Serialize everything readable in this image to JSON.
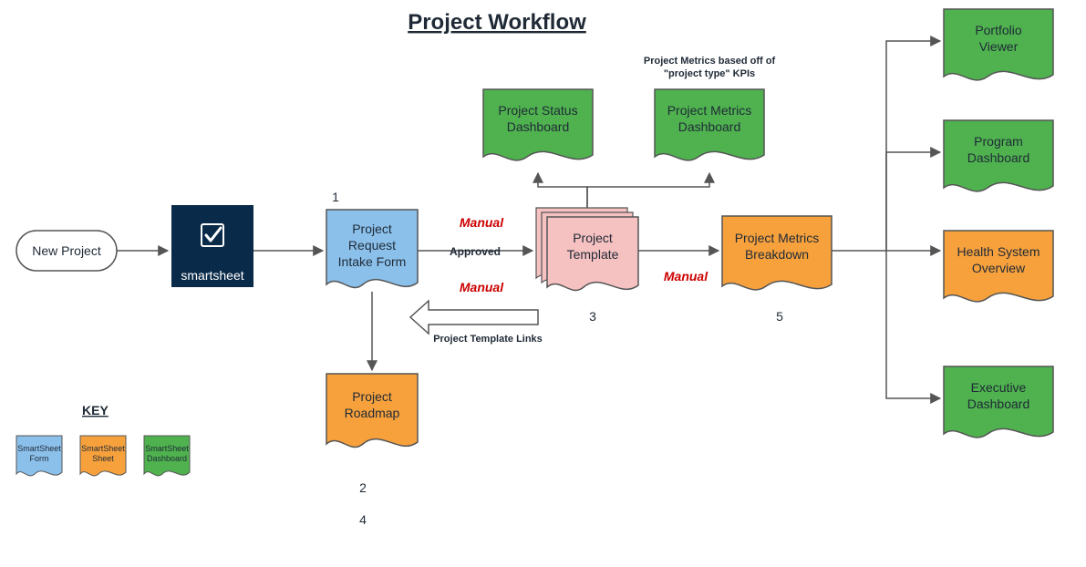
{
  "title": "Project Workflow",
  "key": {
    "heading": "KEY",
    "form": {
      "line1": "SmartSheet",
      "line2": "Form"
    },
    "sheet": {
      "line1": "SmartSheet",
      "line2": "Sheet"
    },
    "dashboard": {
      "line1": "SmartSheet",
      "line2": "Dashboard"
    }
  },
  "nodes": {
    "newProject": "New Project",
    "smartsheet": "smartsheet",
    "intake": {
      "line1": "Project",
      "line2": "Request",
      "line3": "Intake Form"
    },
    "roadmap": {
      "line1": "Project",
      "line2": "Roadmap"
    },
    "template": {
      "line1": "Project",
      "line2": "Template"
    },
    "status": {
      "line1": "Project Status",
      "line2": "Dashboard"
    },
    "metricsDash": {
      "line1": "Project Metrics",
      "line2": "Dashboard"
    },
    "metricsBreak": {
      "line1": "Project Metrics",
      "line2": "Breakdown"
    },
    "portfolio": {
      "line1": "Portfolio",
      "line2": "Viewer"
    },
    "program": {
      "line1": "Program",
      "line2": "Dashboard"
    },
    "health": {
      "line1": "Health System",
      "line2": "Overview"
    },
    "exec": {
      "line1": "Executive",
      "line2": "Dashboard"
    }
  },
  "labels": {
    "approved": "Approved",
    "manual": "Manual",
    "templateLinks": "Project Template Links",
    "metricsNote": {
      "line1": "Project Metrics based off of",
      "line2": "\"project type\" KPIs"
    }
  },
  "numbers": {
    "n1": "1",
    "n2": "2",
    "n3": "3",
    "n4": "4",
    "n5": "5"
  },
  "colors": {
    "blue": "#8bc0eb",
    "orange": "#f7a13d",
    "green": "#4fb24f",
    "pink": "#f6c1c1",
    "navy": "#0a2a4a",
    "stroke": "#555555"
  }
}
